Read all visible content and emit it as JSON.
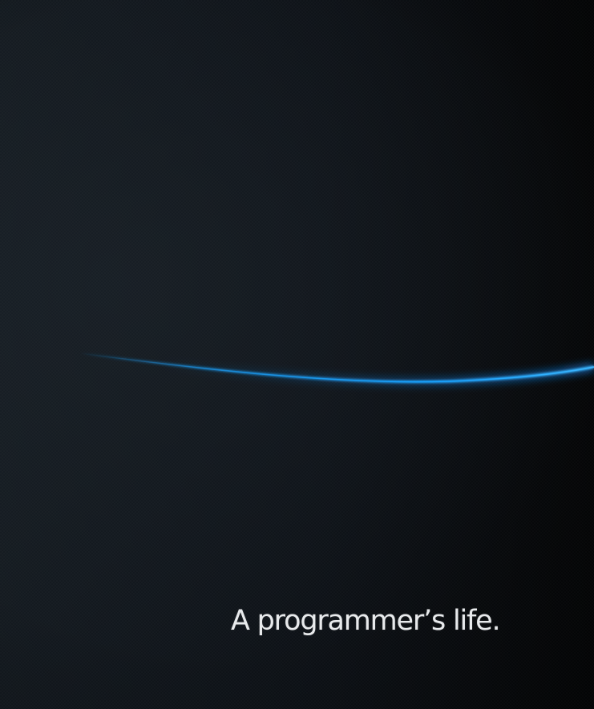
{
  "wallpaper": {
    "tagline": "A programmer’s life.",
    "background_color": "#0d1116",
    "streak_color": "#1aa3ff",
    "text_color": "#e8eaec"
  }
}
